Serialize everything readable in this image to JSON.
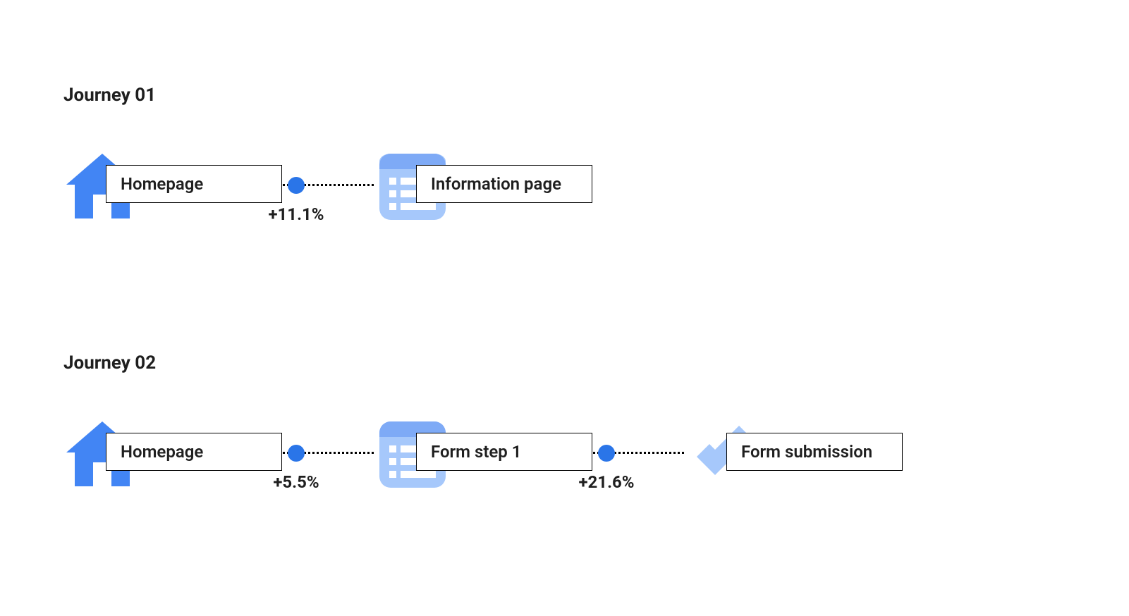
{
  "colors": {
    "primary_blue": "#4285f4",
    "light_blue": "#a6c8fb",
    "dot_blue": "#2a75e8"
  },
  "journeys": [
    {
      "title": "Journey 01",
      "steps": [
        {
          "label": "Homepage",
          "icon": "home"
        },
        {
          "label": "Information page",
          "icon": "list-page"
        }
      ],
      "connectors": [
        {
          "label": "+11.1%"
        }
      ]
    },
    {
      "title": "Journey 02",
      "steps": [
        {
          "label": "Homepage",
          "icon": "home"
        },
        {
          "label": "Form step 1",
          "icon": "list-page"
        },
        {
          "label": "Form submission",
          "icon": "checkmark"
        }
      ],
      "connectors": [
        {
          "label": "+5.5%"
        },
        {
          "label": "+21.6%"
        }
      ]
    }
  ]
}
